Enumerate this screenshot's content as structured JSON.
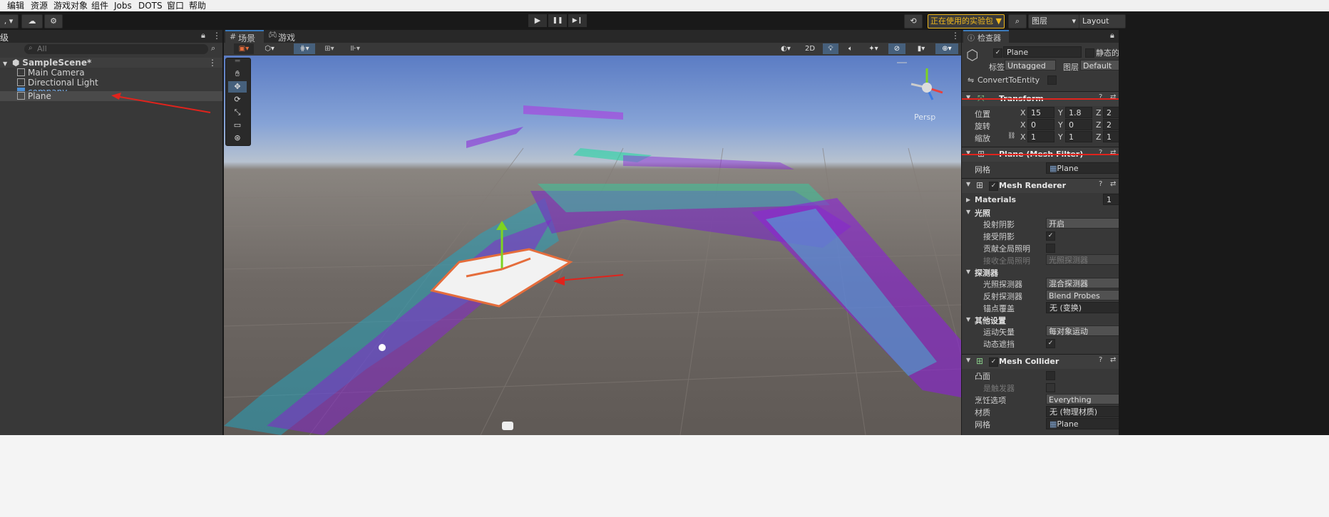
{
  "menu": [
    "编辑",
    "资源",
    "游戏对象",
    "组件",
    "Jobs",
    "DOTS",
    "窗口",
    "帮助"
  ],
  "toolbar": {
    "left_dropdown": ",",
    "cloud_icon": "cloud-icon",
    "settings_icon": "gear-icon",
    "play": "▶",
    "pause": "❚❚",
    "step": "▶❙",
    "package_badge": "正在使用的实验包 ▼",
    "layers": "图层",
    "layout": "Layout"
  },
  "hierarchy": {
    "tab": "级",
    "search_placeholder": "All",
    "scene": "SampleScene*",
    "items": [
      "Main Camera",
      "Directional Light",
      "company",
      "Plane"
    ]
  },
  "scene_view": {
    "tab_scene": "场景",
    "tab_game": "游戏",
    "mode_2d": "2D",
    "persp": "Persp"
  },
  "inspector": {
    "tab": "检查器",
    "object_name": "Plane",
    "static_label": "静态的",
    "tag_label": "标签",
    "tag_value": "Untagged",
    "layer_label": "图层",
    "layer_value": "Default",
    "convert": "ConvertToEntity",
    "transform": {
      "title": "Transform",
      "position_label": "位置",
      "rotation_label": "旋转",
      "scale_label": "缩放",
      "pos": {
        "x": "15",
        "y": "1.8",
        "z": "2"
      },
      "rot": {
        "x": "0",
        "y": "0",
        "z": "2"
      },
      "scale": {
        "x": "1",
        "y": "1",
        "z": "1"
      }
    },
    "mesh_filter": {
      "title": "Plane (Mesh Filter)",
      "mesh_label": "网格",
      "mesh_value": "Plane"
    },
    "mesh_renderer": {
      "title": "Mesh Renderer",
      "materials": "Materials",
      "materials_count": "1",
      "lighting": "光照",
      "cast_shadows": "投射阴影",
      "cast_shadows_value": "开启",
      "receive_shadows": "接受阴影",
      "contribute_gi": "贡献全局照明",
      "receive_gi": "接收全局照明",
      "receive_gi_value": "光照探测器",
      "probes": "探测器",
      "light_probes": "光照探测器",
      "light_probes_value": "混合探测器",
      "reflection_probes": "反射探测器",
      "reflection_probes_value": "Blend Probes",
      "anchor_override": "锚点覆盖",
      "anchor_override_value": "无 (变换)",
      "other": "其他设置",
      "motion_vectors": "运动矢量",
      "motion_vectors_value": "每对象运动",
      "dynamic_occlusion": "动态遮挡"
    },
    "mesh_collider": {
      "title": "Mesh Collider",
      "convex": "凸面",
      "is_trigger": "是触发器",
      "cooking": "烹饪选项",
      "cooking_value": "Everything",
      "material": "材质",
      "material_value": "无 (物理材质)",
      "mesh": "网格",
      "mesh_value": "Plane"
    }
  },
  "colors": {
    "accent": "#2c5d87",
    "annotation": "#e0231c",
    "badge": "#f0b81c"
  }
}
